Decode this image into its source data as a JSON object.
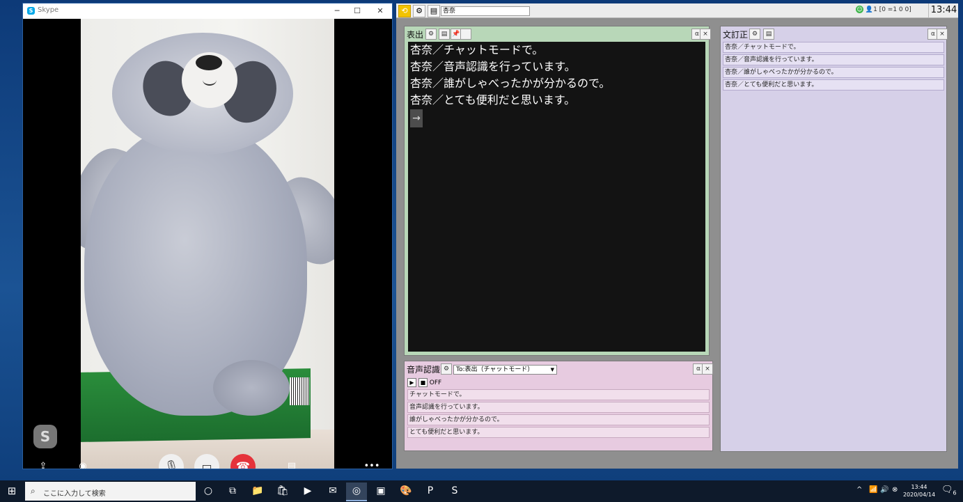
{
  "skype": {
    "title": "Skype",
    "logo_letter": "S",
    "minimize": "─",
    "maximize": "☐",
    "close": "✕",
    "watermark_letter": "S",
    "controls": [
      "share-icon",
      "record-icon",
      "mic-icon",
      "video-icon",
      "hangup-icon",
      "chat-icon",
      "more-icon"
    ],
    "glyphs": {
      "share": "⇪",
      "record": "◉",
      "mic": "🎙",
      "video": "▭",
      "hangup": "☎",
      "chat": "▤",
      "more": "•••"
    }
  },
  "app": {
    "name_value": "杏奈",
    "status_text": "1 [0 =1 0 0]",
    "clock": "13:44",
    "output_panel": {
      "title": "表出",
      "alpha": "α",
      "close": "×",
      "lines": [
        "杏奈／チャットモードで。",
        "杏奈／音声認識を行っています。",
        "杏奈／誰がしゃべったかが分かるので。",
        "杏奈／とても便利だと思います。"
      ],
      "arrow": "→"
    },
    "recognition_panel": {
      "title": "音声認識",
      "target": "To:表出（チャットモード）",
      "dropdown": "▼",
      "play": "▶",
      "stop": "■",
      "state": "OFF",
      "alpha": "α",
      "close": "×",
      "items": [
        "チャットモードで。",
        "音声認識を行っています。",
        "誰がしゃべったかが分かるので。",
        "とても便利だと思います。"
      ]
    },
    "doc_panel": {
      "title": "文訂正",
      "alpha": "α",
      "close": "×",
      "items": [
        "杏奈／チャットモードで。",
        "杏奈／音声認識を行っています。",
        "杏奈／誰がしゃべったかが分かるので。",
        "杏奈／とても便利だと思います。"
      ]
    }
  },
  "taskbar": {
    "start": "⊞",
    "search_placeholder": "ここに入力して検索",
    "time": "13:44",
    "date": "2020/04/14",
    "notification_count": "6"
  }
}
